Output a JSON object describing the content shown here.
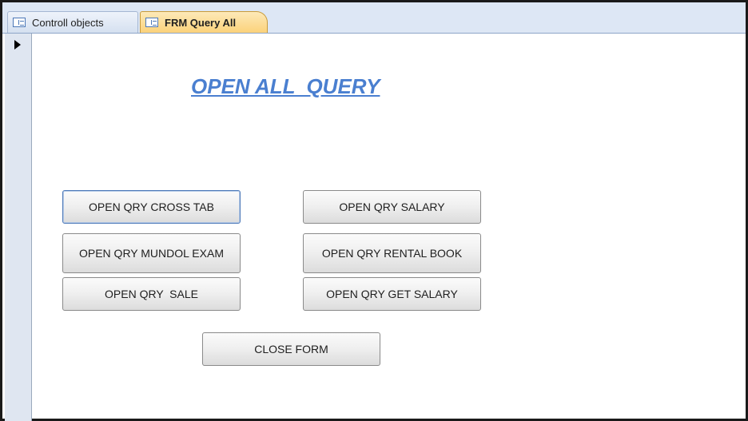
{
  "tabs": [
    {
      "label": "Controll objects",
      "active": false
    },
    {
      "label": "FRM Query All",
      "active": true
    }
  ],
  "form": {
    "title": "OPEN ALL  QUERY",
    "buttons": {
      "cross_tab": "OPEN QRY CROSS TAB",
      "salary": "OPEN QRY SALARY",
      "mundol_exam": "OPEN QRY MUNDOL EXAM",
      "rental_book": "OPEN QRY RENTAL BOOK",
      "sale": "OPEN QRY  SALE",
      "get_salary": "OPEN QRY GET SALARY",
      "close_form": "CLOSE FORM"
    }
  },
  "colors": {
    "title": "#4a7fd0",
    "active_tab": "#fbd27a",
    "tab_bar": "#dde7f5"
  },
  "icons": {
    "tab_icon": "form-icon",
    "record_selector": "current-record-arrow-icon"
  }
}
